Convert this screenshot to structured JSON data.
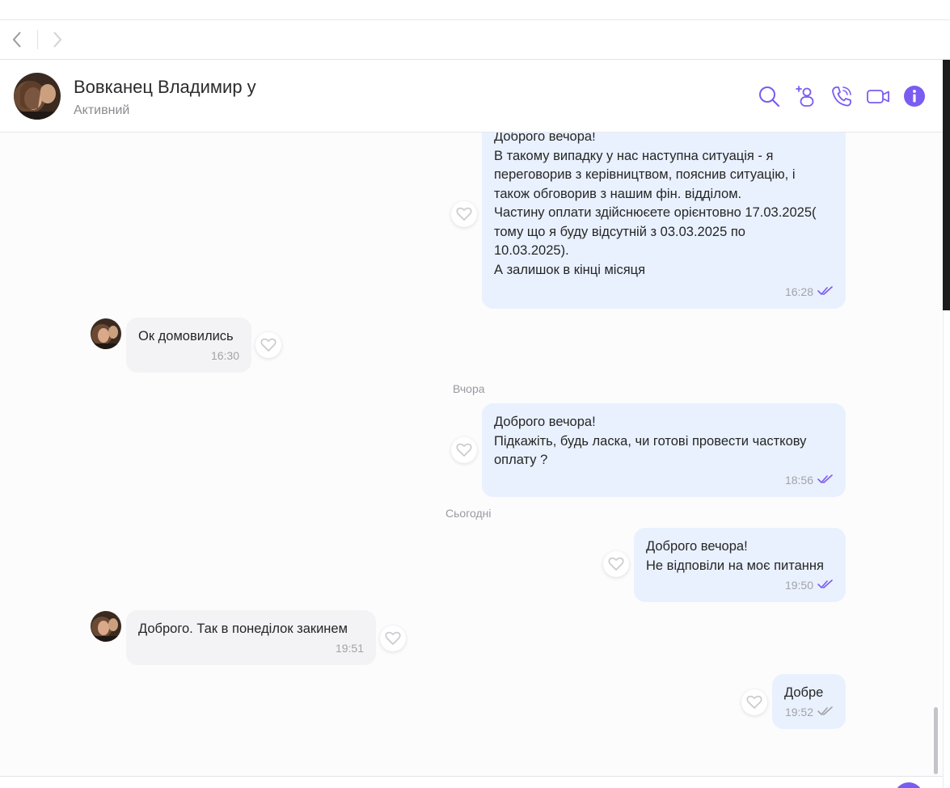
{
  "contact": {
    "name": "Вовканец Владимир у",
    "status": "Активний"
  },
  "header_icons": [
    "search-icon",
    "add-participant-icon",
    "call-icon",
    "video-call-icon",
    "info-icon"
  ],
  "colors": {
    "accent": "#7a5cf0",
    "outgoing_bubble": "#e9f1fe",
    "incoming_bubble": "#f3f3f5",
    "read_tick": "#7a5cf0",
    "delivered_tick": "#a3a3a8"
  },
  "messages": [
    {
      "direction": "out",
      "text": "Доброго вечора!\nВ такому випадку у нас наступна ситуація - я\nпереговорив з керівництвом, пояснив ситуацію, і\nтакож обговорив з нашим фін. відділом.\nЧастину оплати здійснюєете орієнтовно 17.03.2025(\nтому що я буду відсутній з 03.03.2025 по\n10.03.2025).\nА залишок в кінці місяця",
      "time": "16:28",
      "status": "read"
    },
    {
      "direction": "in",
      "text": "Ок домовились",
      "time": "16:30"
    },
    {
      "direction": "out",
      "text": "Доброго вечора!\nПідкажіть, будь ласка, чи готові провести часткову\nоплату ?",
      "time": "18:56",
      "status": "read"
    },
    {
      "direction": "out",
      "text": "Доброго вечора!\nНе відповіли на моє питання",
      "time": "19:50",
      "status": "read"
    },
    {
      "direction": "in",
      "text": "Доброго. Так в понеділок закинем",
      "time": "19:51"
    },
    {
      "direction": "out",
      "text": "Добре",
      "time": "19:52",
      "status": "delivered"
    }
  ],
  "date_separators": [
    "Вчора",
    "Сьогодні"
  ]
}
